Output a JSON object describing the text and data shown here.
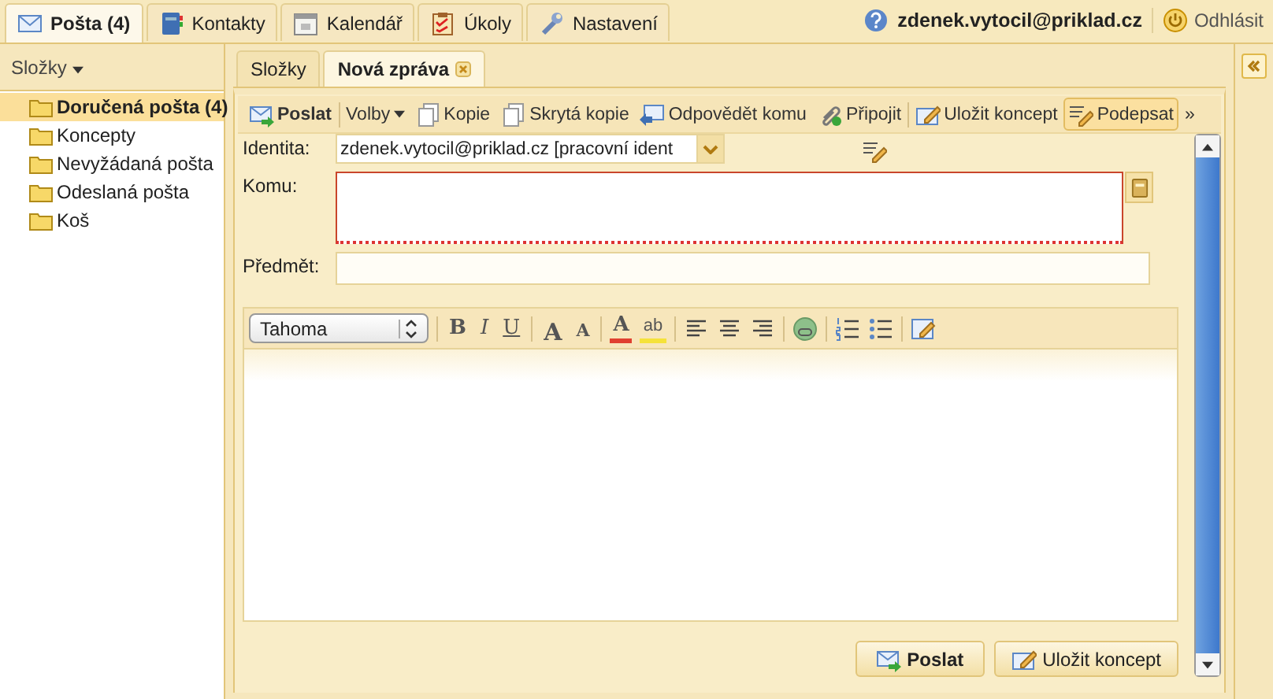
{
  "top_tabs": [
    {
      "kind": "mail",
      "label": "Pošta (4)",
      "selected": true
    },
    {
      "kind": "contacts",
      "label": "Kontakty",
      "selected": false
    },
    {
      "kind": "calendar",
      "label": "Kalendář",
      "selected": false
    },
    {
      "kind": "tasks",
      "label": "Úkoly",
      "selected": false
    },
    {
      "kind": "settings",
      "label": "Nastavení",
      "selected": false
    }
  ],
  "user": {
    "email": "zdenek.vytocil@priklad.cz",
    "logout": "Odhlásit"
  },
  "sidebar": {
    "header": "Složky",
    "folders": [
      {
        "label": "Doručená pošta (4)",
        "selected": true
      },
      {
        "label": "Koncepty",
        "selected": false
      },
      {
        "label": "Nevyžádaná pošta",
        "selected": false
      },
      {
        "label": "Odeslaná pošta",
        "selected": false
      },
      {
        "label": "Koš",
        "selected": false
      }
    ]
  },
  "tabs": [
    {
      "label": "Složky",
      "selected": false,
      "closable": false
    },
    {
      "label": "Nová zpráva",
      "selected": true,
      "closable": true
    }
  ],
  "toolbar": [
    {
      "kind": "send",
      "label": "Poslat",
      "pressed": false
    },
    {
      "kind": "separator"
    },
    {
      "kind": "menu",
      "label": "Volby",
      "pressed": false
    },
    {
      "kind": "copy",
      "label": "Kopie",
      "pressed": false
    },
    {
      "kind": "copy",
      "label": "Skrytá kopie",
      "pressed": false
    },
    {
      "kind": "reply",
      "label": "Odpovědět komu",
      "pressed": false
    },
    {
      "kind": "attach",
      "label": "Připojit",
      "pressed": false
    },
    {
      "kind": "separator"
    },
    {
      "kind": "draft",
      "label": "Uložit koncept",
      "pressed": false
    },
    {
      "kind": "sign",
      "label": "Podepsat",
      "pressed": true
    },
    {
      "kind": "more",
      "label": "»",
      "pressed": false
    }
  ],
  "form": {
    "identity_label": "Identita:",
    "identity_value": "zdenek.vytocil@priklad.cz [pracovní ident",
    "to_label": "Komu:",
    "subject_label": "Předmět:"
  },
  "editor_toolbar": {
    "font": "Tahoma",
    "buttons": [
      {
        "kind": "sep"
      },
      {
        "kind": "bold",
        "label": "B"
      },
      {
        "kind": "italic",
        "label": "I"
      },
      {
        "kind": "underline",
        "label": "U"
      },
      {
        "kind": "sep"
      },
      {
        "kind": "grow",
        "label": "A"
      },
      {
        "kind": "shrink",
        "label": "A"
      },
      {
        "kind": "sep"
      },
      {
        "kind": "color",
        "label": "A"
      },
      {
        "kind": "highlight",
        "label": "ab"
      },
      {
        "kind": "sep"
      },
      {
        "kind": "align-left"
      },
      {
        "kind": "align-center"
      },
      {
        "kind": "align-right"
      },
      {
        "kind": "sep"
      },
      {
        "kind": "link"
      },
      {
        "kind": "sep"
      },
      {
        "kind": "ol"
      },
      {
        "kind": "ul"
      },
      {
        "kind": "sep"
      },
      {
        "kind": "source"
      }
    ]
  },
  "footer_buttons": [
    {
      "kind": "send",
      "label": "Poslat"
    },
    {
      "kind": "draft",
      "label": "Uložit koncept"
    }
  ]
}
